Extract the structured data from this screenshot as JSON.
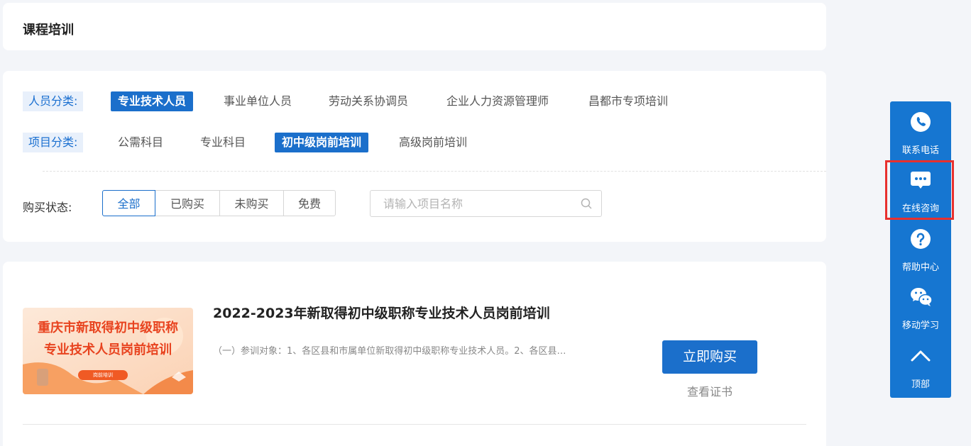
{
  "page": {
    "title": "课程培训"
  },
  "filters": {
    "person_label": "人员分类:",
    "person_options": [
      "专业技术人员",
      "事业单位人员",
      "劳动关系协调员",
      "企业人力资源管理师",
      "昌都市专项培训"
    ],
    "project_label": "项目分类:",
    "project_options": [
      "公需科目",
      "专业科目",
      "初中级岗前培训",
      "高级岗前培训"
    ],
    "buy_label": "购买状态:",
    "buy_options": [
      "全部",
      "已购买",
      "未购买",
      "免费"
    ],
    "search_placeholder": "请输入项目名称"
  },
  "course": {
    "thumb_line1": "重庆市新取得初中级职称",
    "thumb_line2": "专业技术人员岗前培训",
    "thumb_badge": "岗前培训",
    "title": "2022-2023年新取得初中级职称专业技术人员岗前培训",
    "description": "（一）参训对象：1、各区县和市属单位新取得初中级职称专业技术人员。2、各区县…",
    "buy_label": "立即购买",
    "cert_label": "查看证书"
  },
  "sidebar": {
    "items": [
      {
        "label": "联系电话",
        "icon": "phone-icon"
      },
      {
        "label": "在线咨询",
        "icon": "chat-icon"
      },
      {
        "label": "帮助中心",
        "icon": "help-icon"
      },
      {
        "label": "移动学习",
        "icon": "wechat-icon"
      },
      {
        "label": "顶部",
        "icon": "arrow-up-icon"
      }
    ]
  },
  "colors": {
    "primary": "#1b6fcb",
    "sidebar": "#1676d1",
    "highlight": "#e8302e",
    "background": "#f3f5f9"
  }
}
